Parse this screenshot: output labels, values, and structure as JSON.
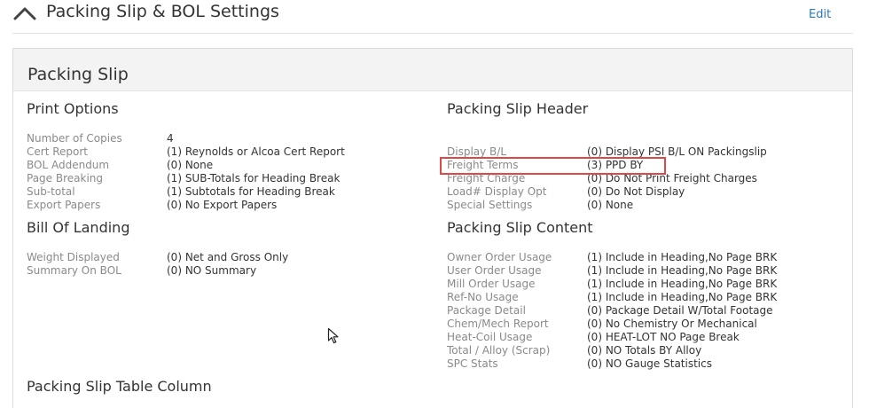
{
  "section": {
    "title": "Packing Slip & BOL Settings",
    "edit_label": "Edit"
  },
  "panel": {
    "title": "Packing Slip"
  },
  "print_options": {
    "title": "Print Options",
    "rows": [
      {
        "label": "Number of Copies",
        "value": "4"
      },
      {
        "label": "Cert Report",
        "value": "(1) Reynolds or Alcoa Cert Report"
      },
      {
        "label": "BOL Addendum",
        "value": "(0) None"
      },
      {
        "label": "Page Breaking",
        "value": "(1) SUB-Totals for Heading Break"
      },
      {
        "label": "Sub-total",
        "value": "(1) Subtotals for Heading Break"
      },
      {
        "label": "Export Papers",
        "value": "(0) No Export Papers"
      }
    ]
  },
  "bill_of_landing": {
    "title": "Bill Of Landing",
    "rows": [
      {
        "label": "Weight Displayed",
        "value": "(0) Net and Gross Only"
      },
      {
        "label": "Summary On BOL",
        "value": "(0) NO Summary"
      }
    ]
  },
  "packing_slip_header": {
    "title": "Packing Slip Header",
    "rows": [
      {
        "label": "Display B/L",
        "value": "(0) Display PSI B/L ON Packingslip"
      },
      {
        "label": "Freight Terms",
        "value": "(3) PPD BY"
      },
      {
        "label": "Freight Charge",
        "value": "(0) Do Not Print Freight Charges"
      },
      {
        "label": "Load# Display Opt",
        "value": "(0) Do Not Display"
      },
      {
        "label": "Special Settings",
        "value": "(0) None"
      }
    ]
  },
  "packing_slip_content": {
    "title": "Packing Slip Content",
    "rows": [
      {
        "label": "Owner Order Usage",
        "value": "(1) Include in Heading,No Page BRK"
      },
      {
        "label": "User Order Usage",
        "value": "(1) Include in Heading,No Page BRK"
      },
      {
        "label": "Mill Order Usage",
        "value": "(1) Include in Heading,No Page BRK"
      },
      {
        "label": "Ref-No Usage",
        "value": "(1) Include in Heading,No Page BRK"
      },
      {
        "label": "Package Detail",
        "value": "(0) Package Detail W/Total Footage"
      },
      {
        "label": "Chem/Mech Report",
        "value": "(0) No Chemistry Or Mechanical"
      },
      {
        "label": "Heat-Coil Usage",
        "value": "(0) HEAT-LOT NO Page Break"
      },
      {
        "label": "Total / Alloy (Scrap)",
        "value": "(0) NO Totals BY Alloy"
      },
      {
        "label": "SPC Stats",
        "value": "(0) NO Gauge Statistics"
      }
    ]
  },
  "table_column": {
    "title": "Packing Slip Table Column"
  },
  "colors": {
    "link": "#2a7ab8",
    "highlight": "#e04848",
    "label": "#8a8a8a"
  },
  "icons": {
    "collapse": "chevron-up-icon",
    "cursor": "mouse-cursor-icon"
  }
}
